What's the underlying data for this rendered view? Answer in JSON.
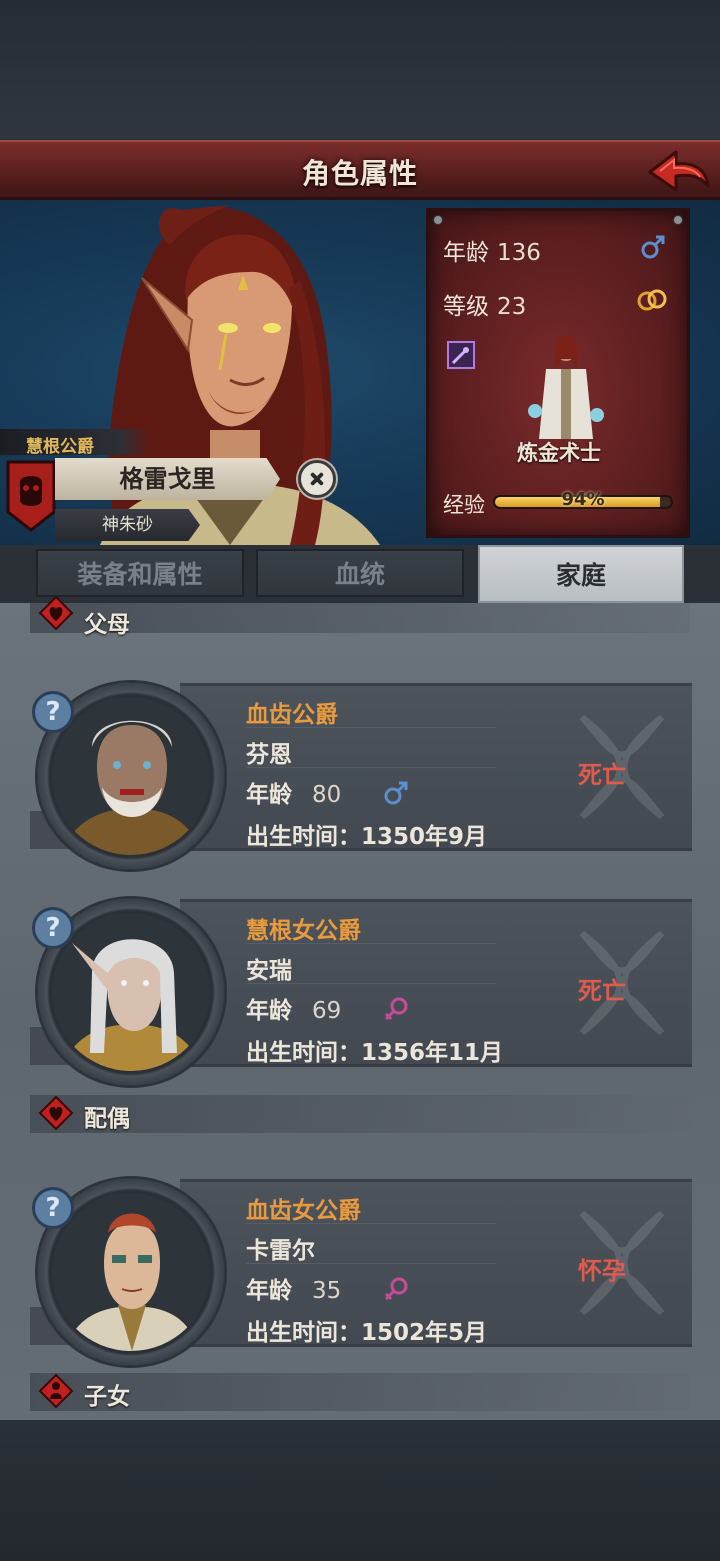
{
  "header": {
    "title": "角色属性"
  },
  "character": {
    "title_tag": "慧根公爵",
    "name": "格雷戈里",
    "sub_title": "神朱砂"
  },
  "stats": {
    "age_label": "年龄",
    "age_value": "136",
    "level_label": "等级",
    "level_value": "23",
    "class_name": "炼金术士",
    "exp_label": "经验",
    "exp_percent_text": "94%",
    "exp_fraction": 0.94
  },
  "tabs": [
    {
      "label": "装备和属性",
      "active": false
    },
    {
      "label": "血统",
      "active": false
    },
    {
      "label": "家庭",
      "active": true
    }
  ],
  "sections": {
    "parents": "父母",
    "spouse": "配偶",
    "children": "子女"
  },
  "parents": [
    {
      "title": "血齿公爵",
      "name": "芬恩",
      "age_label": "年龄",
      "age": "80",
      "gender": "male",
      "birth": "出生时间：1350年9月",
      "status": "死亡"
    },
    {
      "title": "慧根女公爵",
      "name": "安瑞",
      "age_label": "年龄",
      "age": "69",
      "gender": "female",
      "birth": "出生时间：1356年11月",
      "status": "死亡"
    }
  ],
  "spouse": [
    {
      "title": "血齿女公爵",
      "name": "卡雷尔",
      "age_label": "年龄",
      "age": "35",
      "gender": "female",
      "birth": "出生时间：1502年5月",
      "status": "怀孕"
    }
  ],
  "colors": {
    "accent_red": "#5a1f1f",
    "title_orange": "#e89a3c",
    "status_red": "#e05a4e",
    "male_blue": "#5b8fd0",
    "female_pink": "#c84a9a"
  },
  "icons": {
    "back": "back-arrow-icon",
    "close": "close-icon",
    "male": "male-icon",
    "female": "female-icon",
    "ring": "ring-icon",
    "staff": "staff-icon",
    "help": "help-icon",
    "heart": "heart-icon",
    "child": "child-icon"
  }
}
